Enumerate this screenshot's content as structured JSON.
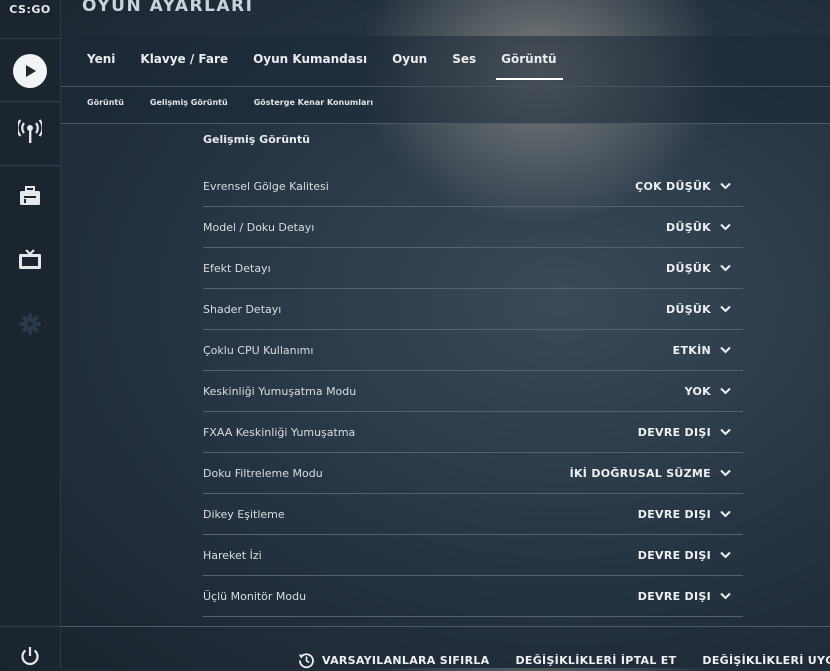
{
  "app": {
    "logo_text": "CS:GO",
    "title": "OYUN AYARLARI"
  },
  "sidebar": {
    "icons": [
      "play-icon",
      "broadcast-icon",
      "briefcase-icon",
      "tv-icon",
      "gear-icon",
      "power-icon"
    ]
  },
  "tabs": [
    {
      "label": "Yeni",
      "active": false
    },
    {
      "label": "Klavye / Fare",
      "active": false
    },
    {
      "label": "Oyun Kumandası",
      "active": false
    },
    {
      "label": "Oyun",
      "active": false
    },
    {
      "label": "Ses",
      "active": false
    },
    {
      "label": "Görüntü",
      "active": true
    }
  ],
  "subtabs": [
    {
      "label": "Görüntü"
    },
    {
      "label": "Gelişmiş Görüntü"
    },
    {
      "label": "Gösterge Kenar Konumları"
    }
  ],
  "section": {
    "title": "Gelişmiş Görüntü"
  },
  "settings": [
    {
      "label": "Evrensel Gölge Kalitesi",
      "value": "ÇOK DÜŞÜK"
    },
    {
      "label": "Model / Doku Detayı",
      "value": "DÜŞÜK"
    },
    {
      "label": "Efekt Detayı",
      "value": "DÜŞÜK"
    },
    {
      "label": "Shader Detayı",
      "value": "DÜŞÜK"
    },
    {
      "label": "Çoklu CPU Kullanımı",
      "value": "ETKİN"
    },
    {
      "label": "Keskinliği Yumuşatma Modu",
      "value": "YOK"
    },
    {
      "label": "FXAA Keskinliği Yumuşatma",
      "value": "DEVRE DIŞI"
    },
    {
      "label": "Doku Filtreleme Modu",
      "value": "İKİ DOĞRUSAL SÜZME"
    },
    {
      "label": "Dikey Eşitleme",
      "value": "DEVRE DIŞI"
    },
    {
      "label": "Hareket İzi",
      "value": "DEVRE DIŞI"
    },
    {
      "label": "Üçlü Monitör Modu",
      "value": "DEVRE DIŞI"
    }
  ],
  "footer": {
    "reset_label": "VARSAYILANLARA SIFIRLA",
    "cancel_label": "DEĞİŞİKLİKLERİ İPTAL ET",
    "apply_label": "DEĞİŞİKLİKLERİ UYGULA"
  }
}
